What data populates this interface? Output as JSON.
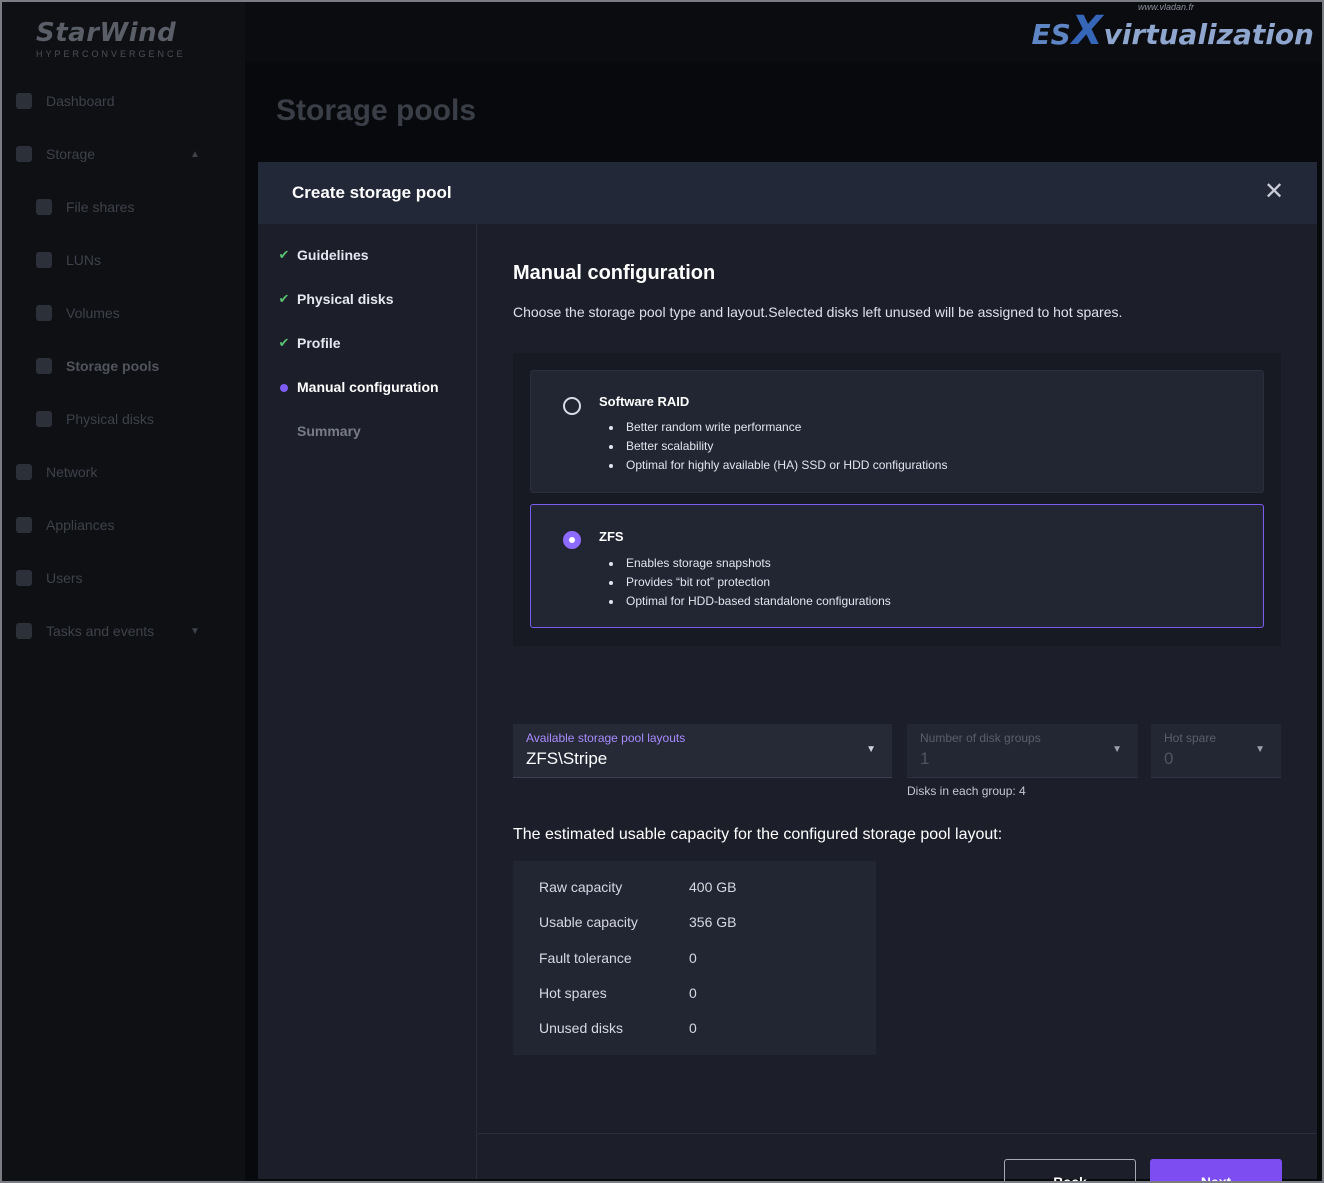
{
  "app": {
    "brand_name": "StarWind",
    "brand_sub": "HYPERCONVERGENCE",
    "page_title": "Storage pools"
  },
  "watermark": {
    "url": "www.vladan.fr",
    "part1": "ES",
    "part2": "X",
    "part3": "virtualization"
  },
  "sidebar": {
    "items": [
      {
        "label": "Dashboard",
        "icon": "dashboard-icon"
      },
      {
        "label": "Storage",
        "icon": "storage-icon",
        "caret": "▲"
      },
      {
        "label": "File shares",
        "icon": "file-shares-icon"
      },
      {
        "label": "LUNs",
        "icon": "luns-icon"
      },
      {
        "label": "Volumes",
        "icon": "volumes-icon"
      },
      {
        "label": "Storage pools",
        "icon": "storage-pools-icon"
      },
      {
        "label": "Physical disks",
        "icon": "physical-disks-icon"
      },
      {
        "label": "Network",
        "icon": "network-icon"
      },
      {
        "label": "Appliances",
        "icon": "appliances-icon"
      },
      {
        "label": "Users",
        "icon": "users-icon"
      },
      {
        "label": "Tasks and events",
        "icon": "tasks-icon",
        "caret": "▼"
      }
    ]
  },
  "modal": {
    "title": "Create storage pool",
    "close_glyph": "✕",
    "steps": [
      {
        "label": "Guidelines",
        "state": "done"
      },
      {
        "label": "Physical disks",
        "state": "done"
      },
      {
        "label": "Profile",
        "state": "done"
      },
      {
        "label": "Manual configuration",
        "state": "current"
      },
      {
        "label": "Summary",
        "state": "pending"
      }
    ],
    "section_title": "Manual configuration",
    "section_desc": "Choose the storage pool type and layout.Selected disks left unused will be assigned to hot spares.",
    "types": [
      {
        "title": "Software RAID",
        "selected": false,
        "bullets": [
          "Better random write performance",
          "Better scalability",
          "Optimal for highly available (HA) SSD or HDD configurations"
        ]
      },
      {
        "title": "ZFS",
        "selected": true,
        "bullets": [
          "Enables storage snapshots",
          "Provides “bit rot” protection",
          "Optimal for HDD-based standalone configurations"
        ]
      }
    ],
    "layout_select": {
      "label": "Available storage pool layouts",
      "value": "ZFS\\Stripe"
    },
    "disk_groups_select": {
      "label": "Number of disk groups",
      "value": "1"
    },
    "hot_spare_select": {
      "label": "Hot spare",
      "value": "0"
    },
    "disks_hint": "Disks in each group: 4",
    "capacity_title": "The estimated usable capacity for the configured storage pool layout:",
    "capacity": [
      {
        "key": "Raw capacity",
        "value": "400 GB"
      },
      {
        "key": "Usable capacity",
        "value": "356 GB"
      },
      {
        "key": "Fault tolerance",
        "value": "0"
      },
      {
        "key": "Hot spares",
        "value": "0"
      },
      {
        "key": "Unused disks",
        "value": "0"
      }
    ],
    "back_label": "Back",
    "next_label": "Next"
  },
  "colors": {
    "accent": "#7c5cf0",
    "check": "#58c271",
    "modal_bg": "#1c1f2a"
  }
}
